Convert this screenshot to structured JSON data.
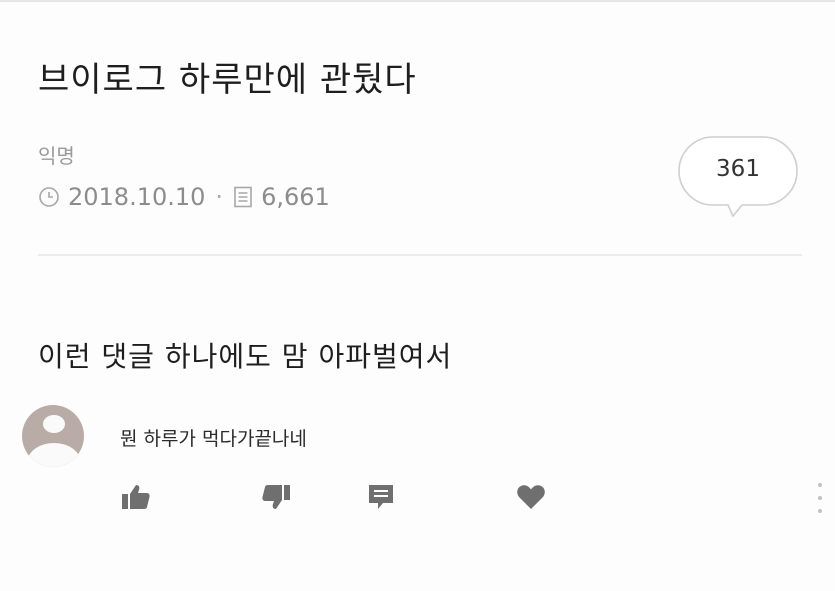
{
  "post": {
    "title": "브이로그 하루만에 관뒀다",
    "author": "익명",
    "date": "2018.10.10",
    "views": "6,661",
    "comment_count": "361"
  },
  "body": {
    "text": "이런 댓글 하나에도 맘 아파벌여서"
  },
  "comment": {
    "text": "뭔 하루가 먹다가끝나네"
  },
  "icons": {
    "date": "clock-icon",
    "views": "document-icon",
    "like": "thumbs-up-icon",
    "dislike": "thumbs-down-icon",
    "reply": "comment-icon",
    "favorite": "heart-icon",
    "more": "more-vertical-icon"
  },
  "colors": {
    "icon": "#6f6f6f",
    "text_muted": "#8c8c8c"
  }
}
